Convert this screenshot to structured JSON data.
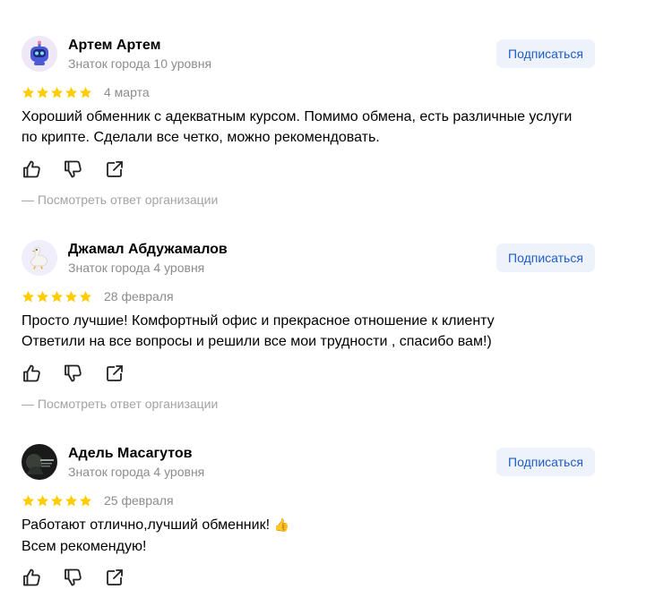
{
  "subscribe_label": "Подписаться",
  "reply_link_label": "— Посмотреть ответ организации",
  "rating_star_color": "#fc3f1d",
  "reviews": [
    {
      "author": "Артем Артем",
      "level": "Знаток города 10 уровня",
      "rating": 5,
      "date": "4 марта",
      "text_lines": [
        "Хороший обменник с адекватным курсом. Помимо обмена, есть различные услуги",
        "по крипте. Сделали все четко, можно рекомендовать."
      ],
      "avatar_icon": "robot-avatar-icon"
    },
    {
      "author": "Джамал Абдужамалов",
      "level": "Знаток города 4 уровня",
      "rating": 5,
      "date": "28 февраля",
      "text_lines": [
        "Просто лучшие! Комфортный офис и прекрасное отношение к клиенту",
        "Ответили на все вопросы и решили все мои трудности , спасибо вам!)"
      ],
      "avatar_icon": "goose-avatar-icon"
    },
    {
      "author": "Адель Масагутов",
      "level": "Знаток города 4 уровня",
      "rating": 5,
      "date": "25 февраля",
      "text_lines": [
        "Работают отлично,лучший обменник!",
        "Всем рекомендую!"
      ],
      "text_emoji": "👍",
      "avatar_icon": "photo-avatar"
    }
  ]
}
